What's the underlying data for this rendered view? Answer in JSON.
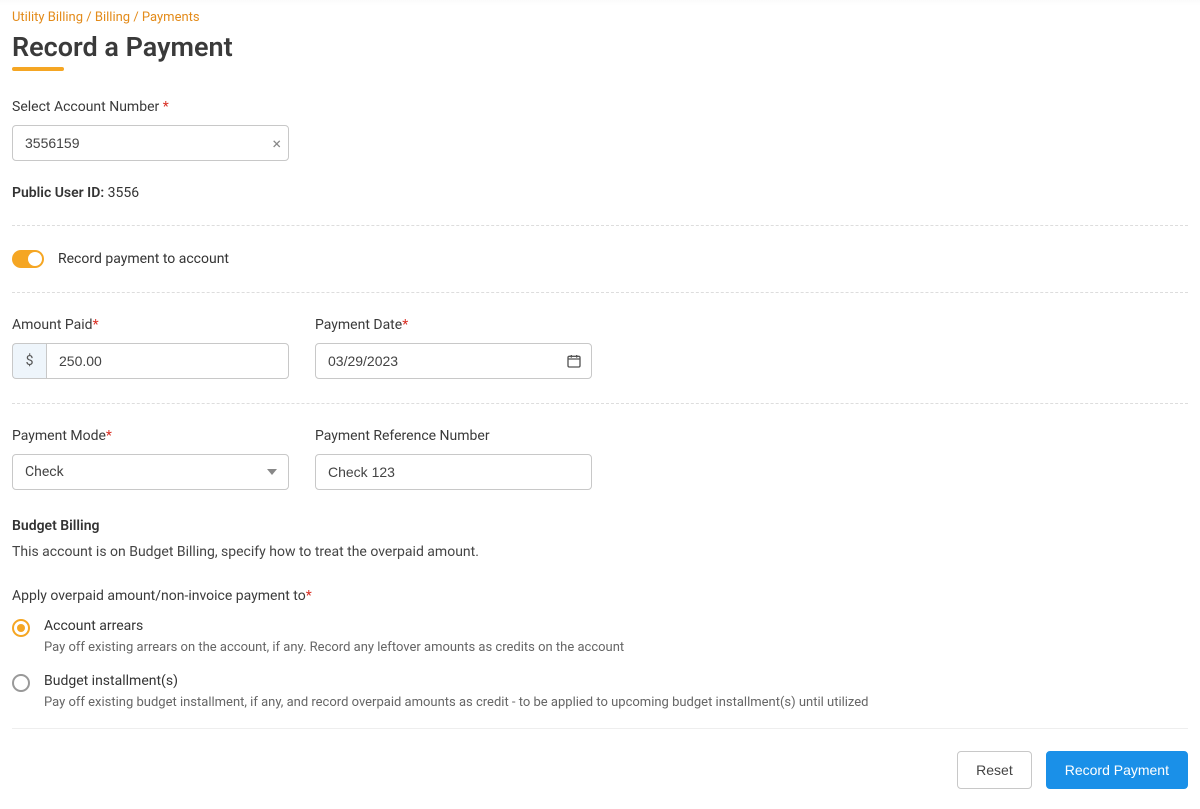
{
  "breadcrumb": {
    "level1": "Utility Billing",
    "level2": "Billing",
    "level3": "Payments",
    "sep": " / "
  },
  "page": {
    "title": "Record a Payment"
  },
  "account": {
    "label": "Select Account Number ",
    "value": "3556159",
    "public_user_label": "Public User ID:",
    "public_user_value": " 3556"
  },
  "toggle": {
    "label": "Record payment to account"
  },
  "amount": {
    "label": "Amount Paid",
    "currency": "$",
    "value": "250.00"
  },
  "payment_date": {
    "label": "Payment Date",
    "value": "03/29/2023"
  },
  "payment_mode": {
    "label": "Payment Mode",
    "value": "Check"
  },
  "payment_ref": {
    "label": "Payment Reference Number",
    "value": "Check 123"
  },
  "budget": {
    "heading": "Budget Billing",
    "desc": "This account is on Budget Billing, specify how to treat the overpaid amount."
  },
  "overpaid": {
    "label": "Apply overpaid amount/non-invoice payment to",
    "options": [
      {
        "title": "Account arrears",
        "desc": "Pay off existing arrears on the account, if any. Record any leftover amounts as credits on the account"
      },
      {
        "title": "Budget installment(s)",
        "desc": "Pay off existing budget installment, if any, and record overpaid amounts as credit - to be applied to upcoming budget installment(s) until utilized"
      }
    ]
  },
  "buttons": {
    "reset": "Reset",
    "submit": "Record Payment"
  }
}
